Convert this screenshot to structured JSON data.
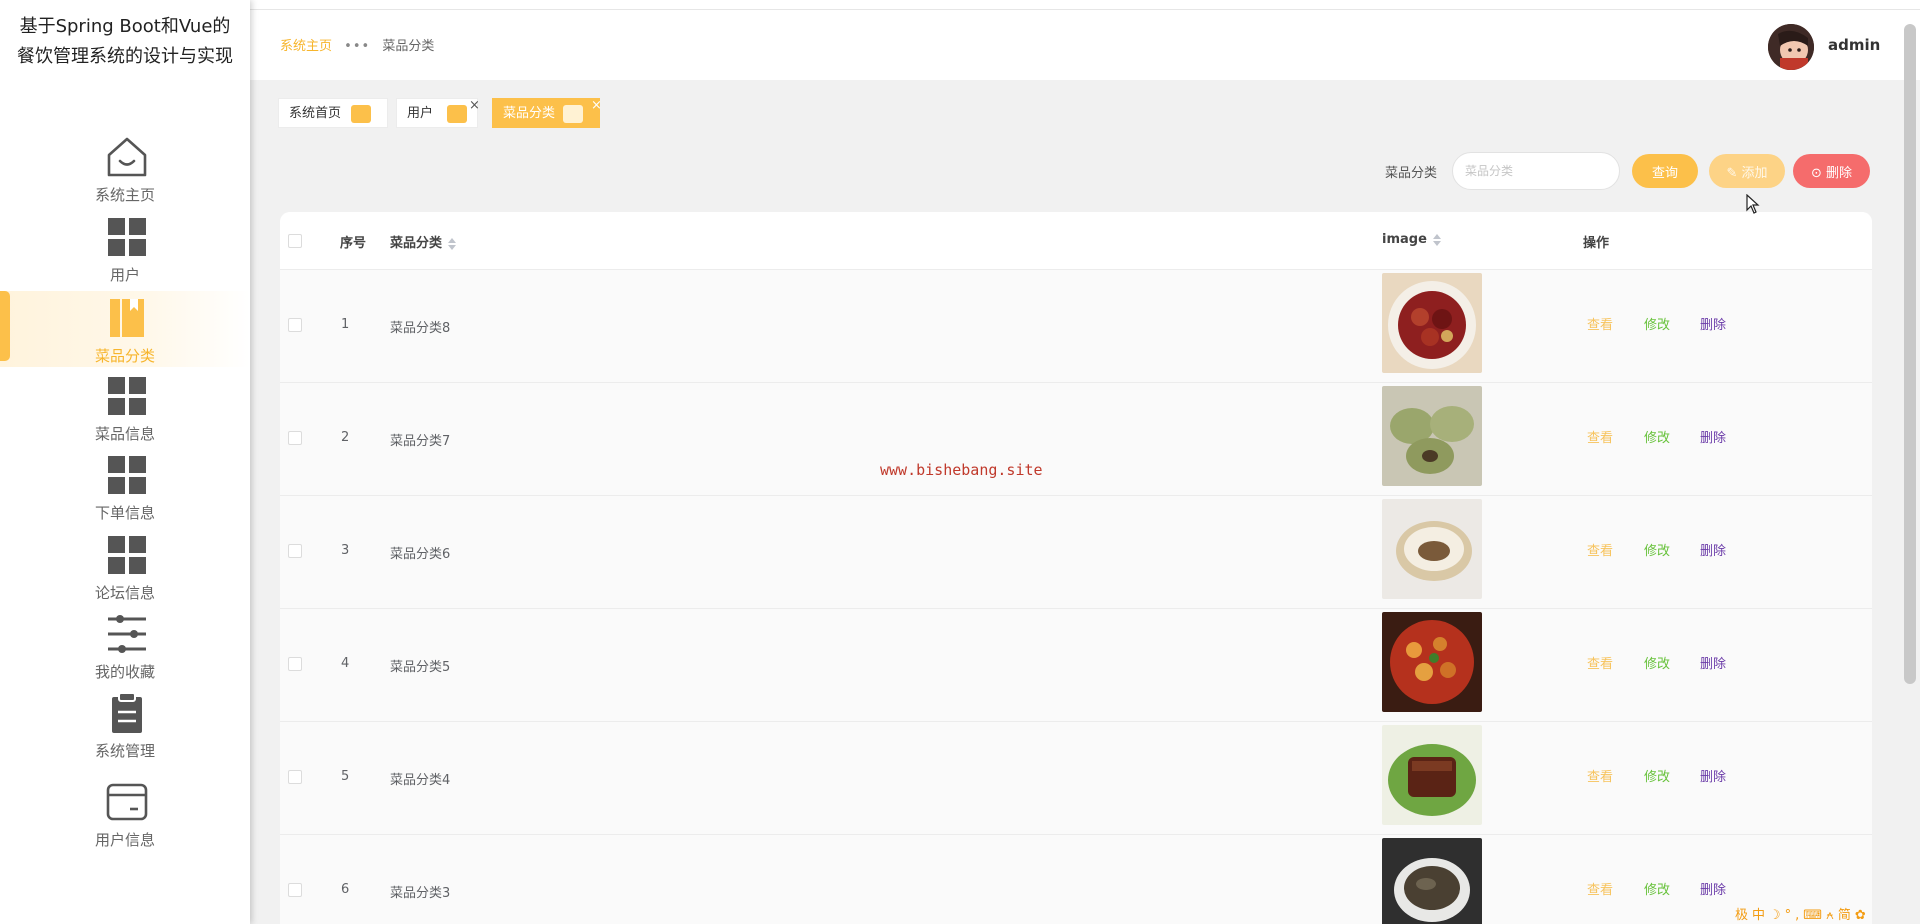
{
  "brand": {
    "title": "基于Spring Boot和Vue的餐饮管理系统的设计与实现"
  },
  "sidebar": {
    "items": [
      {
        "label": "系统主页",
        "icon": "home-icon"
      },
      {
        "label": "用户",
        "icon": "grid-icon"
      },
      {
        "label": "菜品分类",
        "icon": "book-icon",
        "active": true
      },
      {
        "label": "菜品信息",
        "icon": "grid-icon"
      },
      {
        "label": "下单信息",
        "icon": "grid-icon"
      },
      {
        "label": "论坛信息",
        "icon": "grid-icon"
      },
      {
        "label": "我的收藏",
        "icon": "sliders-icon"
      },
      {
        "label": "系统管理",
        "icon": "clipboard-icon"
      },
      {
        "label": "用户信息",
        "icon": "card-icon"
      }
    ]
  },
  "header": {
    "breadcrumb": {
      "home": "系统主页",
      "separator": "•••",
      "current": "菜品分类"
    },
    "user": {
      "name": "admin"
    }
  },
  "tabs": [
    {
      "label": "系统首页",
      "closable": false
    },
    {
      "label": "用户",
      "closable": true
    },
    {
      "label": "菜品分类",
      "closable": true,
      "active": true
    }
  ],
  "search": {
    "label": "菜品分类",
    "placeholder": "菜品分类",
    "query_label": "查询",
    "add_label": "添加",
    "delete_label": "删除"
  },
  "table": {
    "columns": {
      "index": "序号",
      "category": "菜品分类",
      "image": "image",
      "actions": "操作"
    },
    "action_labels": {
      "view": "查看",
      "edit": "修改",
      "delete": "删除"
    },
    "rows": [
      {
        "index": "1",
        "category": "菜品分类8",
        "image": "braised-meat-photo"
      },
      {
        "index": "2",
        "category": "菜品分类7",
        "image": "green-pastry-photo"
      },
      {
        "index": "3",
        "category": "菜品分类6",
        "image": "stuffed-bun-photo"
      },
      {
        "index": "4",
        "category": "菜品分类5",
        "image": "stir-fry-chicken-photo"
      },
      {
        "index": "5",
        "category": "菜品分类4",
        "image": "pork-belly-photo"
      },
      {
        "index": "6",
        "category": "菜品分类3",
        "image": "soup-bowl-photo"
      }
    ]
  },
  "watermark": "www.bishebang.site",
  "ime_bar": "极中☽°,⌨⍲简✿",
  "colors": {
    "accent": "#fcc04a",
    "danger": "#f56c6c",
    "edit": "#67c23a",
    "delete_link": "#6a3aa8"
  }
}
